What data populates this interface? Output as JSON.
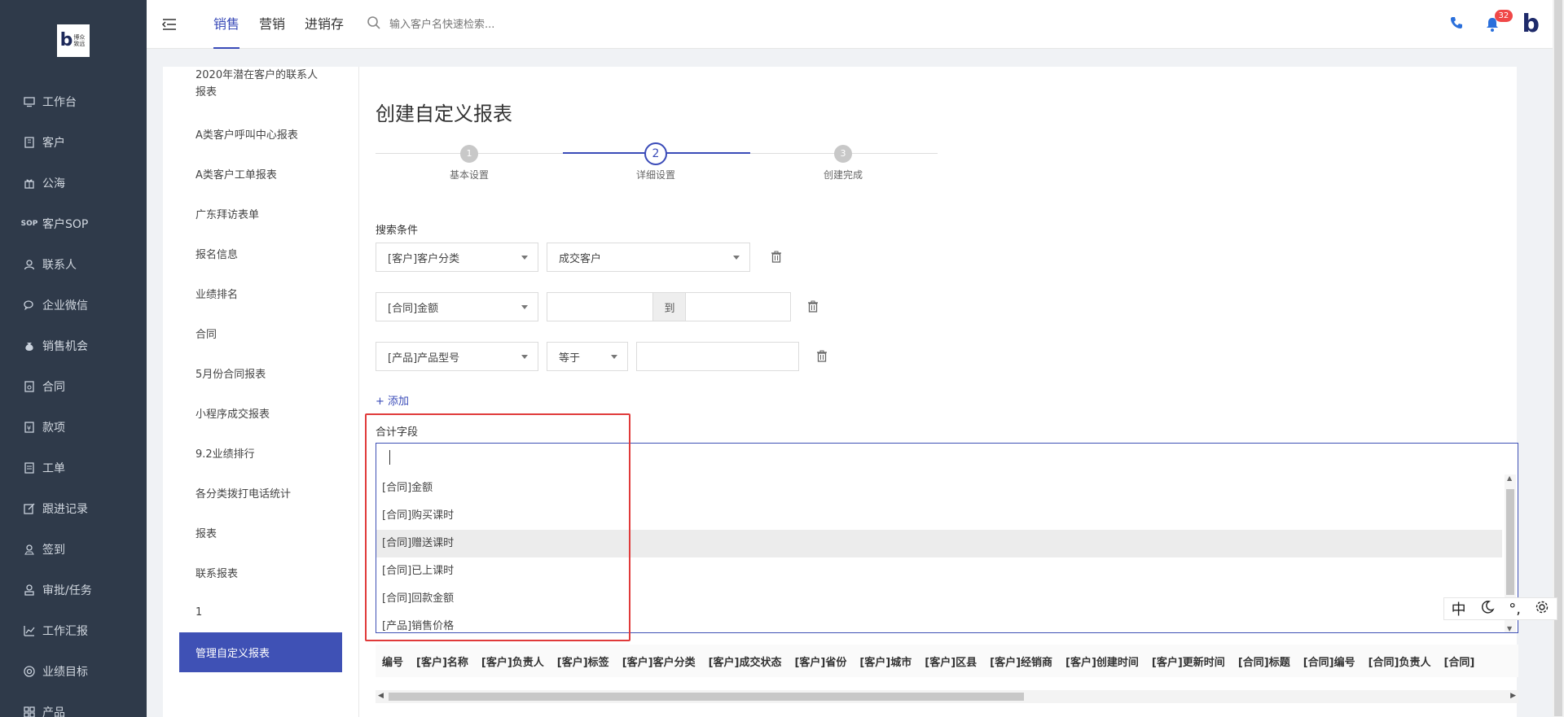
{
  "logo": {
    "text": "博众致远"
  },
  "sidebar": {
    "items": [
      {
        "label": "工作台",
        "icon": "desktop-icon"
      },
      {
        "label": "客户",
        "icon": "building-icon"
      },
      {
        "label": "公海",
        "icon": "gift-icon"
      },
      {
        "label": "客户SOP",
        "icon": "sop-icon"
      },
      {
        "label": "联系人",
        "icon": "user-icon"
      },
      {
        "label": "企业微信",
        "icon": "wechat-icon"
      },
      {
        "label": "销售机会",
        "icon": "moneybag-icon"
      },
      {
        "label": "合同",
        "icon": "contract-icon"
      },
      {
        "label": "款项",
        "icon": "yen-icon"
      },
      {
        "label": "工单",
        "icon": "ticket-icon"
      },
      {
        "label": "跟进记录",
        "icon": "edit-icon"
      },
      {
        "label": "签到",
        "icon": "location-icon"
      },
      {
        "label": "审批/任务",
        "icon": "approval-icon"
      },
      {
        "label": "工作汇报",
        "icon": "report-icon"
      },
      {
        "label": "业绩目标",
        "icon": "target-icon"
      },
      {
        "label": "产品",
        "icon": "grid-icon"
      }
    ]
  },
  "topbar": {
    "tabs": [
      "销售",
      "营销",
      "进销存"
    ],
    "active_tab": "销售",
    "search_placeholder": "输入客户名快速检索...",
    "notification_count": "32",
    "brand_letter": "b"
  },
  "reports": {
    "items": [
      "2020年潜在客户的联系人报表",
      "A类客户呼叫中心报表",
      "A类客户工单报表",
      "广东拜访表单",
      "报名信息",
      "业绩排名",
      "合同",
      "5月份合同报表",
      "小程序成交报表",
      "9.2业绩排行",
      "各分类拨打电话统计",
      "报表",
      "联系报表",
      "1",
      "管理自定义报表"
    ],
    "active": "管理自定义报表"
  },
  "main": {
    "title": "创建自定义报表",
    "steps": [
      {
        "num": "1",
        "label": "基本设置"
      },
      {
        "num": "2",
        "label": "详细设置"
      },
      {
        "num": "3",
        "label": "创建完成"
      }
    ],
    "active_step": 2,
    "search_conditions_label": "搜索条件",
    "conditions": [
      {
        "field": "[客户]客户分类",
        "value": "成交客户"
      },
      {
        "field": "[合同]金额",
        "range_to": "到"
      },
      {
        "field": "[产品]产品型号",
        "operator": "等于"
      }
    ],
    "add_label": "+ 添加",
    "sum_fields_label": "合计字段",
    "dropdown_options": [
      "[合同]金额",
      "[合同]购买课时",
      "[合同]赠送课时",
      "[合同]已上课时",
      "[合同]回款金额",
      "[产品]销售价格"
    ],
    "hovered_option": "[合同]赠送课时",
    "table_headers": [
      "编号",
      "[客户]名称",
      "[客户]负责人",
      "[客户]标签",
      "[客户]客户分类",
      "[客户]成交状态",
      "[客户]省份",
      "[客户]城市",
      "[客户]区县",
      "[客户]经销商",
      "[客户]创建时间",
      "[客户]更新时间",
      "[合同]标题",
      "[合同]编号",
      "[合同]负责人",
      "[合同]"
    ]
  },
  "ime": {
    "mode": "中",
    "punct": "°,"
  }
}
